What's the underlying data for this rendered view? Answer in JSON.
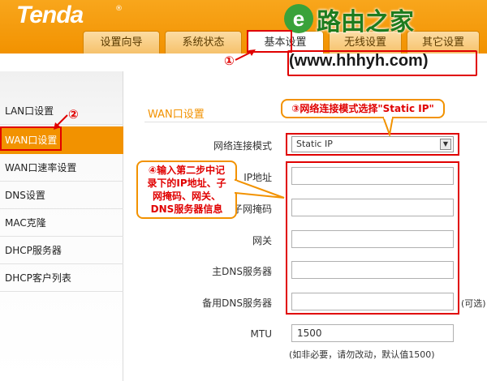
{
  "header": {
    "logo": "Tenda",
    "logo_mark": "®",
    "tabs": [
      {
        "label": "设置向导"
      },
      {
        "label": "系统状态"
      },
      {
        "label": "基本设置"
      },
      {
        "label": "无线设置"
      },
      {
        "label": "其它设置"
      }
    ]
  },
  "watermark": {
    "mark_letter": "e",
    "title": "路由之家",
    "url": "(www.hhhyh.com)"
  },
  "sidebar": {
    "items": [
      {
        "label": "LAN口设置"
      },
      {
        "label": "WAN口设置"
      },
      {
        "label": "WAN口速率设置"
      },
      {
        "label": "DNS设置"
      },
      {
        "label": "MAC克隆"
      },
      {
        "label": "DHCP服务器"
      },
      {
        "label": "DHCP客户列表"
      }
    ]
  },
  "content": {
    "title": "WAN口设置",
    "mode_label": "网络连接模式",
    "mode_value": "Static IP",
    "mode_arrow": "▼",
    "ip_label": "IP地址",
    "mask_label": "子网掩码",
    "gateway_label": "网关",
    "dns1_label": "主DNS服务器",
    "dns2_label": "备用DNS服务器",
    "optional_hint": "(可选)",
    "mtu_label": "MTU",
    "mtu_value": "1500",
    "mtu_hint": "(如非必要，请勿改动，默认值1500)"
  },
  "annotations": {
    "step1": "①",
    "step2": "②",
    "step3": "③网络连接模式选择\"Static IP\"",
    "step4_line1": "④输入第二步中记",
    "step4_line2": "录下的IP地址、子",
    "step4_line3": "网掩码、网关、",
    "step4_line4": "DNS服务器信息"
  },
  "colors": {
    "accent_orange": "#f29200",
    "annotation_red": "#e00000",
    "watermark_green": "#1e7c1e"
  }
}
